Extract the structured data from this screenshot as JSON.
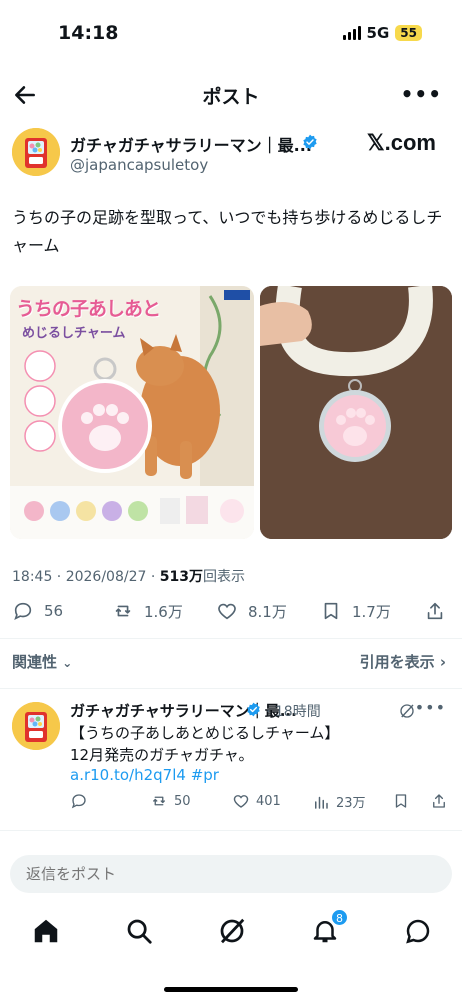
{
  "status": {
    "time": "14:18",
    "network": "5G",
    "battery": "55"
  },
  "nav": {
    "title": "ポスト"
  },
  "post": {
    "author_name": "ガチャガチャサラリーマン｜最...",
    "author_handle": "@japancapsuletoy",
    "source": "𝕏.com",
    "text": "うちの子の足跡を型取って、いつでも持ち歩けるめじるしチャーム",
    "image_title_1": "うちの子あしあと",
    "image_title_2": "めじるしチャーム",
    "time": "18:45 · 2026/08/27 · ",
    "views_count": "513万",
    "views_label": "回表示"
  },
  "actions": {
    "replies": "56",
    "reposts": "1.6万",
    "likes": "8.1万",
    "bookmarks": "1.7万"
  },
  "related": {
    "label": "関連性",
    "quotes": "引用を表示"
  },
  "reply": {
    "author_name": "ガチャガチャサラリーマン｜最...",
    "time": "· 18時間",
    "line1": "【うちの子あしあとめじるしチャーム】",
    "line2": "12月発売のガチャガチャ。",
    "link": "a.r10.to/h2q7l4 #pr",
    "reposts": "50",
    "likes": "401",
    "views": "23万"
  },
  "composer": {
    "placeholder": "返信をポスト"
  },
  "tabs": {
    "notifications_badge": "8"
  },
  "colors": {
    "accent": "#1d9bf0",
    "text": "#0f1419",
    "muted": "#536471",
    "pink": "#f3b6c9"
  }
}
